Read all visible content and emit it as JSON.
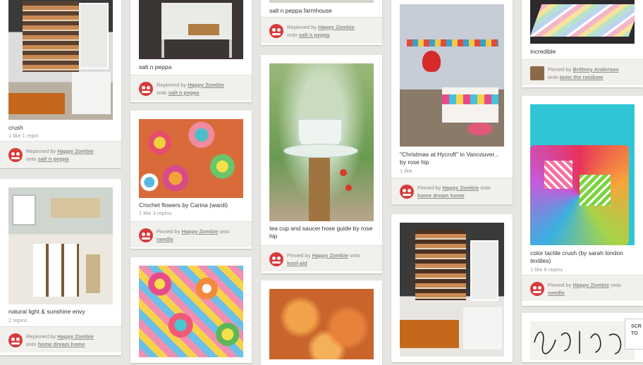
{
  "pins": {
    "crush": {
      "desc": "crush",
      "meta": "1 like  1 repin",
      "verb": "Repinned by",
      "user": "Happy Zombie",
      "board": "salt n peppa"
    },
    "natural": {
      "desc": "natural light & sunshine envy",
      "meta": "2 repins",
      "verb": "Repinned by",
      "user": "Happy Zombie",
      "board": "home dream home"
    },
    "saltpeppa": {
      "desc": "salt n peppa",
      "verb": "Repinned by",
      "user": "Happy Zombie",
      "board": "salt n peppa"
    },
    "crochet": {
      "desc": "Crochet flowers by Carina (wardi)",
      "meta": "1 like  3 repins",
      "verb": "Pinned by",
      "user": "Happy Zombie",
      "board": "needle"
    },
    "farmhouse": {
      "desc": "salt n peppa farmhouse",
      "verb": "Repinned by",
      "user": "Happy Zombie",
      "board": "salt n peppa"
    },
    "teacup": {
      "desc": "tea cup and saucer hose guide by rose hip",
      "verb": "Pinned by",
      "user": "Happy Zombie",
      "board": "kool-aid"
    },
    "christmas": {
      "desc": "\"Christmas at Hycroft\" in Vancouver... by rose hip",
      "meta": "1 like",
      "verb": "Pinned by",
      "user": "Happy Zombie",
      "board": "home dream home"
    },
    "incredible": {
      "desc": "incredible",
      "verb": "Pinned by",
      "user": "Brittney Anderson",
      "board": "taste the rainbow"
    },
    "tactile": {
      "desc": "color tactile crush (by sarah london textiles)",
      "meta": "1 like  6 repins",
      "verb": "Pinned by",
      "user": "Happy Zombie",
      "board": "needle"
    }
  },
  "common": {
    "onto": "onto"
  },
  "scroll_button": "SCR TO"
}
